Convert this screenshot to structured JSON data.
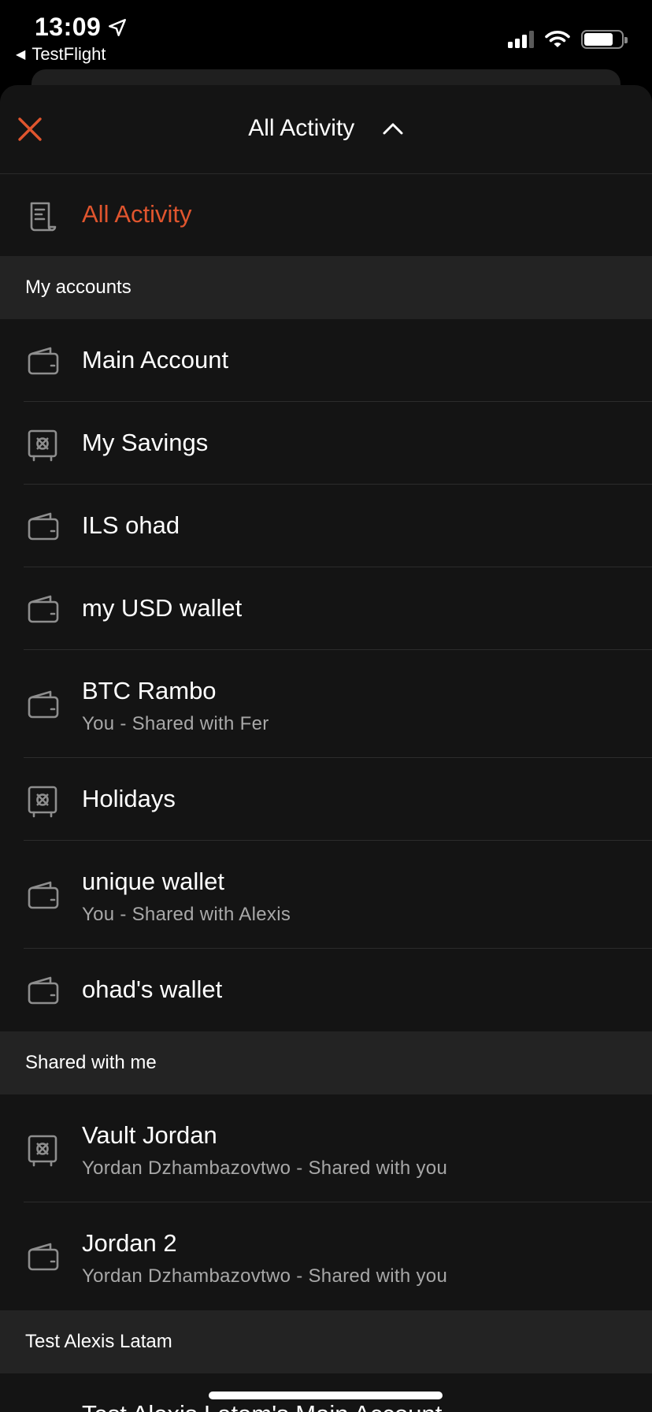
{
  "status_bar": {
    "time": "13:09",
    "back_app": "TestFlight"
  },
  "header": {
    "title": "All Activity"
  },
  "all_activity": {
    "label": "All Activity",
    "icon": "receipt-icon",
    "color": "#e0552e"
  },
  "sections": [
    {
      "title": "My accounts",
      "items": [
        {
          "title": "Main Account",
          "subtitle": "",
          "icon": "wallet-icon"
        },
        {
          "title": "My Savings",
          "subtitle": "",
          "icon": "vault-icon"
        },
        {
          "title": "ILS ohad",
          "subtitle": "",
          "icon": "wallet-icon"
        },
        {
          "title": "my USD wallet",
          "subtitle": "",
          "icon": "wallet-icon"
        },
        {
          "title": "BTC Rambo",
          "subtitle": "You - Shared with Fer",
          "icon": "wallet-icon"
        },
        {
          "title": "Holidays",
          "subtitle": "",
          "icon": "vault-icon"
        },
        {
          "title": "unique wallet",
          "subtitle": "You - Shared with Alexis",
          "icon": "wallet-icon"
        },
        {
          "title": "ohad's wallet",
          "subtitle": "",
          "icon": "wallet-icon"
        }
      ]
    },
    {
      "title": "Shared with me",
      "items": [
        {
          "title": "Vault Jordan",
          "subtitle": "Yordan Dzhambazovtwo - Shared with you",
          "icon": "vault-icon"
        },
        {
          "title": "Jordan 2",
          "subtitle": "Yordan Dzhambazovtwo - Shared with you",
          "icon": "wallet-icon"
        }
      ]
    },
    {
      "title": "Test Alexis Latam",
      "items": [
        {
          "title": "Test Alexis Latam's Main Account",
          "subtitle": "",
          "icon": "wallet-icon"
        }
      ]
    }
  ],
  "colors": {
    "accent": "#e0552e",
    "background": "#141414",
    "section_background": "#232323",
    "subtitle": "#a8a8a8"
  }
}
